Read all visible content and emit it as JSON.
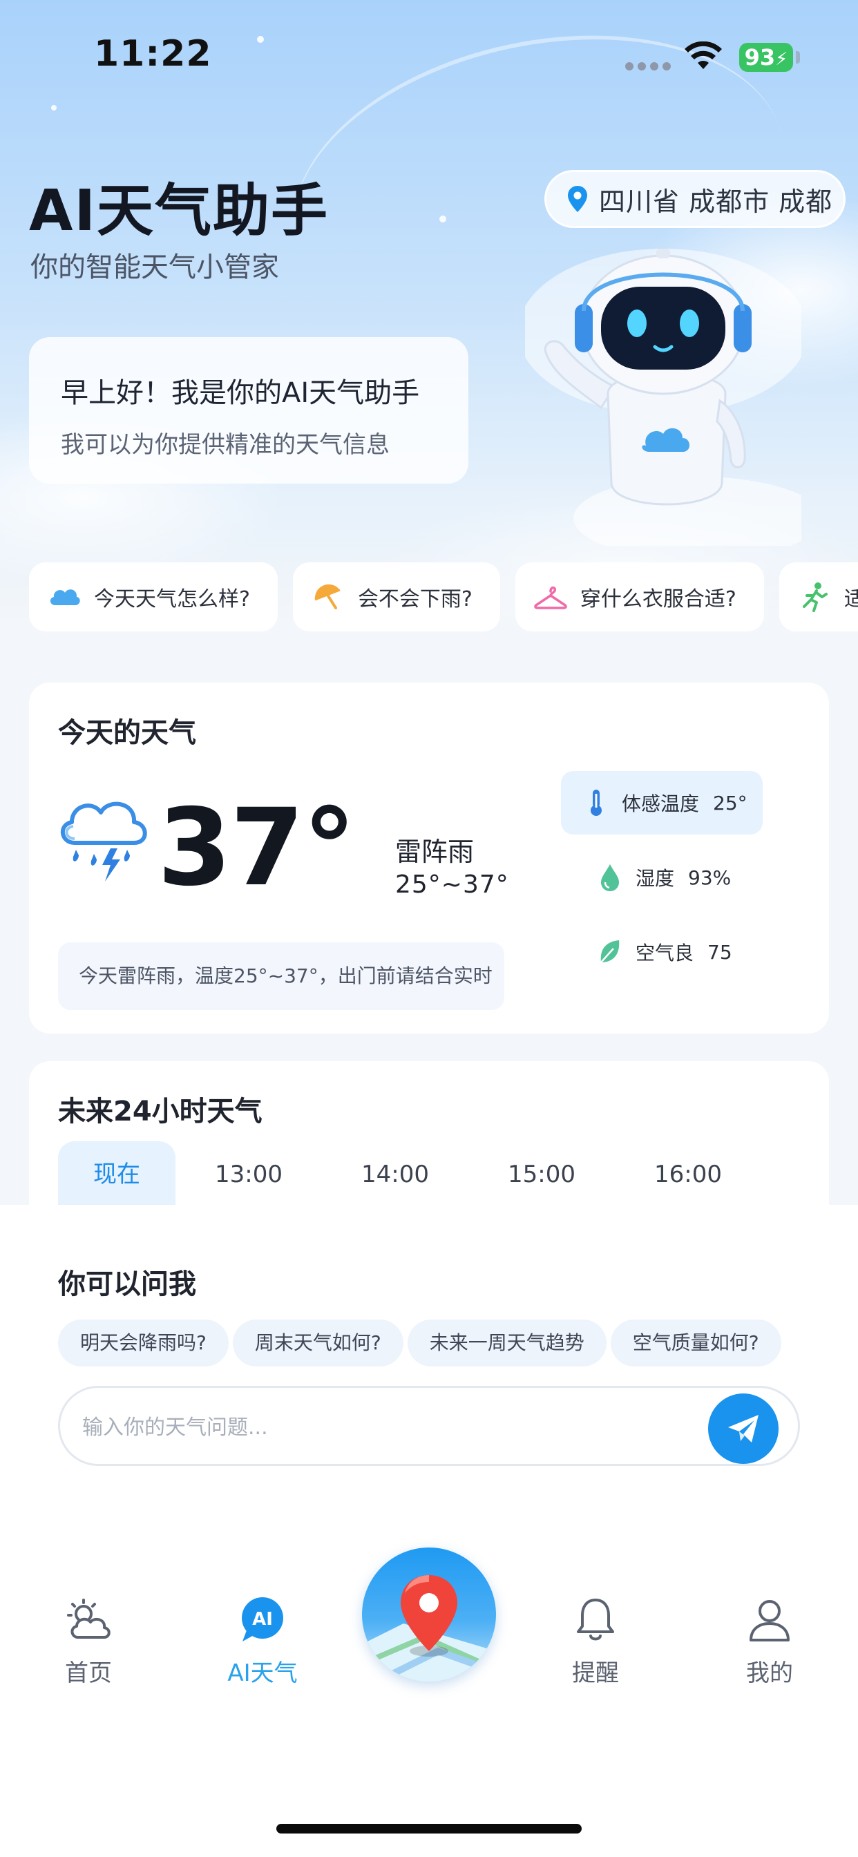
{
  "status_bar": {
    "time": "11:22",
    "battery": "93"
  },
  "header": {
    "title": "AI天气助手",
    "subtitle": "你的智能天气小管家",
    "location": "四川省 成都市 成都"
  },
  "greeting": {
    "title": "早上好！我是你的AI天气助手",
    "subtitle": "我可以为你提供精准的天气信息"
  },
  "quick_questions": [
    {
      "label": "今天天气怎么样?",
      "icon": "cloud-icon"
    },
    {
      "label": "会不会下雨?",
      "icon": "umbrella-icon"
    },
    {
      "label": "穿什么衣服合适?",
      "icon": "hanger-icon"
    },
    {
      "label": "适合户",
      "icon": "running-icon"
    }
  ],
  "today": {
    "title": "今天的天气",
    "temperature": "37°",
    "condition": "雷阵雨",
    "range": "25°~37°",
    "tip": "今天雷阵雨，温度25°~37°，出门前请结合实时",
    "metrics": [
      {
        "label": "体感温度",
        "value": "25°",
        "icon": "thermometer-icon"
      },
      {
        "label": "湿度",
        "value": "93%",
        "icon": "water-drop-icon"
      },
      {
        "label": "空气良",
        "value": "75",
        "icon": "leaf-icon"
      }
    ]
  },
  "hourly": {
    "title": "未来24小时天气",
    "tabs": [
      "现在",
      "13:00",
      "14:00",
      "15:00",
      "16:00"
    ]
  },
  "ask": {
    "title": "你可以问我",
    "suggestions": [
      "明天会降雨吗?",
      "周末天气如何?",
      "未来一周天气趋势",
      "空气质量如何?"
    ],
    "input_placeholder": "输入你的天气问题...",
    "input_value": ""
  },
  "tabbar": {
    "home": "首页",
    "ai_weather": "AI天气",
    "ai_badge": "AI",
    "remind": "提醒",
    "mine": "我的"
  },
  "colors": {
    "accent": "#1a93ee",
    "active_tab": "#2aa1ec",
    "battery": "#39c463"
  }
}
